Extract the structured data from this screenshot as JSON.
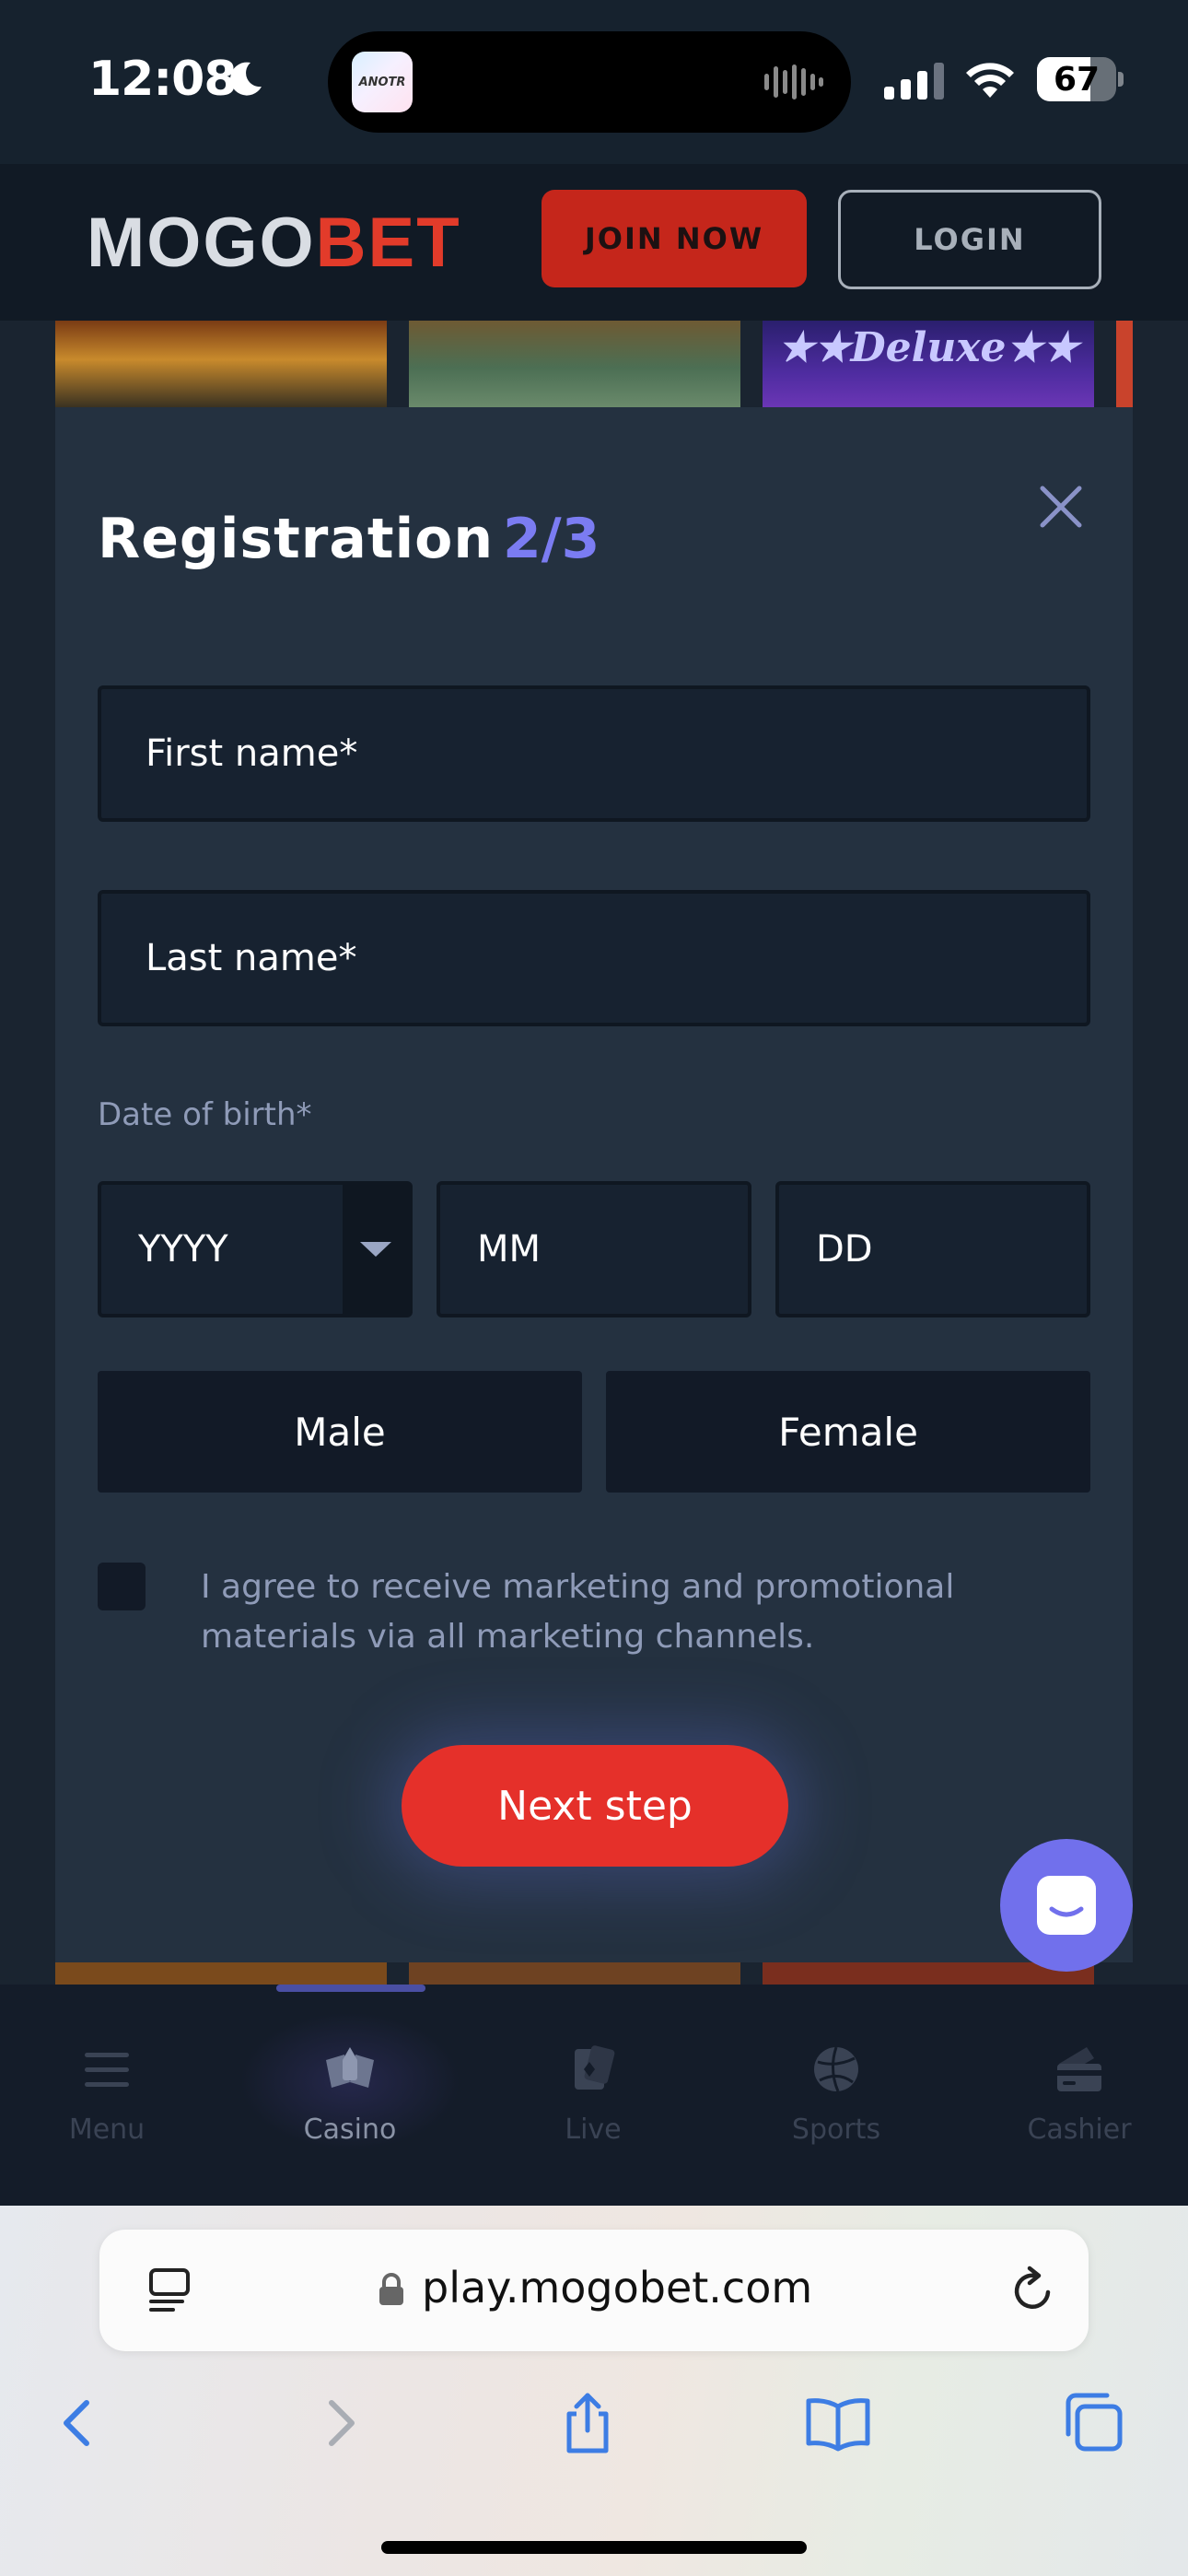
{
  "status_bar": {
    "time": "12:08",
    "battery": 67,
    "icons": [
      "moon-icon",
      "signal-icon",
      "wifi-icon",
      "battery-icon"
    ]
  },
  "island": {
    "app_label": "ANOTR"
  },
  "header": {
    "logo_part1": "MOGO",
    "logo_part2": "BET",
    "join_label": "JOIN NOW",
    "login_label": "LOGIN",
    "colors": {
      "accent": "#e23b2a",
      "brand_text": "#d9dde3"
    }
  },
  "background": {
    "tile_3_text": "★★Deluxe★★"
  },
  "modal": {
    "title": "Registration",
    "step": "2/3",
    "first_name_placeholder": "First name*",
    "last_name_placeholder": "Last name*",
    "dob_label": "Date of birth*",
    "dob_year": "YYYY",
    "dob_month": "MM",
    "dob_day": "DD",
    "gender_male": "Male",
    "gender_female": "Female",
    "consent_text": "I agree to receive marketing and promotional materials via all marketing channels.",
    "consent_checked": false,
    "next_label": "Next step",
    "colors": {
      "step": "#7b7cf2",
      "next_button": "#e5302a"
    }
  },
  "chat": {
    "icon": "chat-icon",
    "color": "#7170ec"
  },
  "bottom_nav": {
    "items": [
      {
        "label": "Menu",
        "icon": "menu-icon",
        "active": false
      },
      {
        "label": "Casino",
        "icon": "casino-icon",
        "active": true
      },
      {
        "label": "Live",
        "icon": "live-cards-icon",
        "active": false
      },
      {
        "label": "Sports",
        "icon": "sports-ball-icon",
        "active": false
      },
      {
        "label": "Cashier",
        "icon": "cashier-icon",
        "active": false
      }
    ]
  },
  "browser": {
    "url": "play.mogobet.com",
    "icons": [
      "reader-icon",
      "lock-icon",
      "reload-icon",
      "back-icon",
      "forward-icon",
      "share-icon",
      "bookmarks-icon",
      "tabs-icon"
    ]
  }
}
